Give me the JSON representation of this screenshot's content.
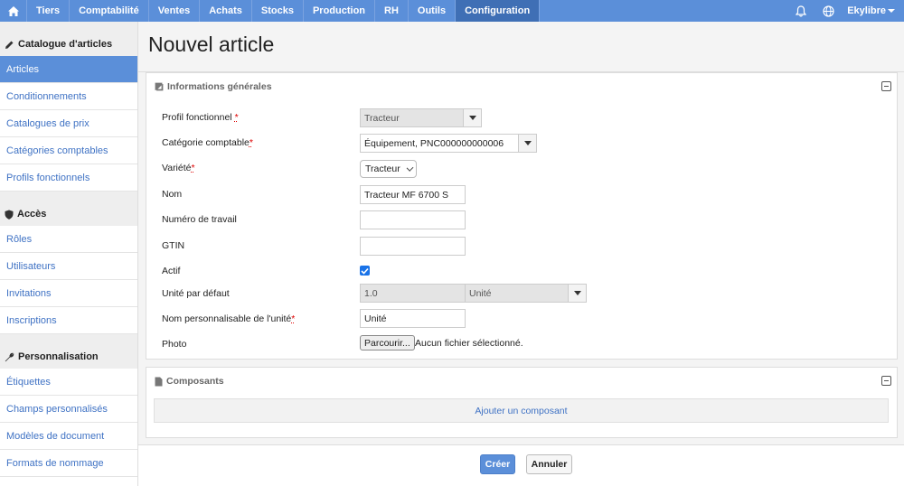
{
  "topnav": {
    "items": [
      "Tiers",
      "Comptabilité",
      "Ventes",
      "Achats",
      "Stocks",
      "Production",
      "RH",
      "Outils",
      "Configuration"
    ],
    "active": "Configuration",
    "user": "Ekylibre",
    "accent": "#5b8fd9"
  },
  "sidebar": {
    "sections": [
      {
        "title": "Catalogue d'articles",
        "icon": "pencil-icon",
        "items": [
          "Articles",
          "Conditionnements",
          "Catalogues de prix",
          "Catégories comptables",
          "Profils fonctionnels"
        ]
      },
      {
        "title": "Accès",
        "icon": "shield-icon",
        "items": [
          "Rôles",
          "Utilisateurs",
          "Invitations",
          "Inscriptions"
        ]
      },
      {
        "title": "Personnalisation",
        "icon": "wrench-icon",
        "items": [
          "Étiquettes",
          "Champs personnalisés",
          "Modèles de document",
          "Formats de nommage"
        ]
      }
    ],
    "active_item": "Articles"
  },
  "page": {
    "title": "Nouvel article"
  },
  "general": {
    "title": "Informations générales",
    "fields": {
      "profil": {
        "label": "Profil fonctionnel",
        "value": "Tracteur"
      },
      "categorie": {
        "label": "Catégorie comptable",
        "value": "Équipement, PNC000000000006"
      },
      "variete": {
        "label": "Variété",
        "value": "Tracteur"
      },
      "nom": {
        "label": "Nom",
        "value": "Tracteur MF 6700 S"
      },
      "numero": {
        "label": "Numéro de travail",
        "value": ""
      },
      "gtin": {
        "label": "GTIN",
        "value": ""
      },
      "actif": {
        "label": "Actif",
        "checked": true
      },
      "unite": {
        "label": "Unité par défaut",
        "value": "1.0",
        "unit": "Unité"
      },
      "nom_unite": {
        "label": "Nom personnalisable de l'unité",
        "value": "Unité"
      },
      "photo": {
        "label": "Photo",
        "button": "Parcourir...",
        "status": "Aucun fichier sélectionné."
      }
    },
    "required_mark": "*"
  },
  "composants": {
    "title": "Composants",
    "add_label": "Ajouter un composant"
  },
  "actions": {
    "create": "Créer",
    "cancel": "Annuler"
  }
}
